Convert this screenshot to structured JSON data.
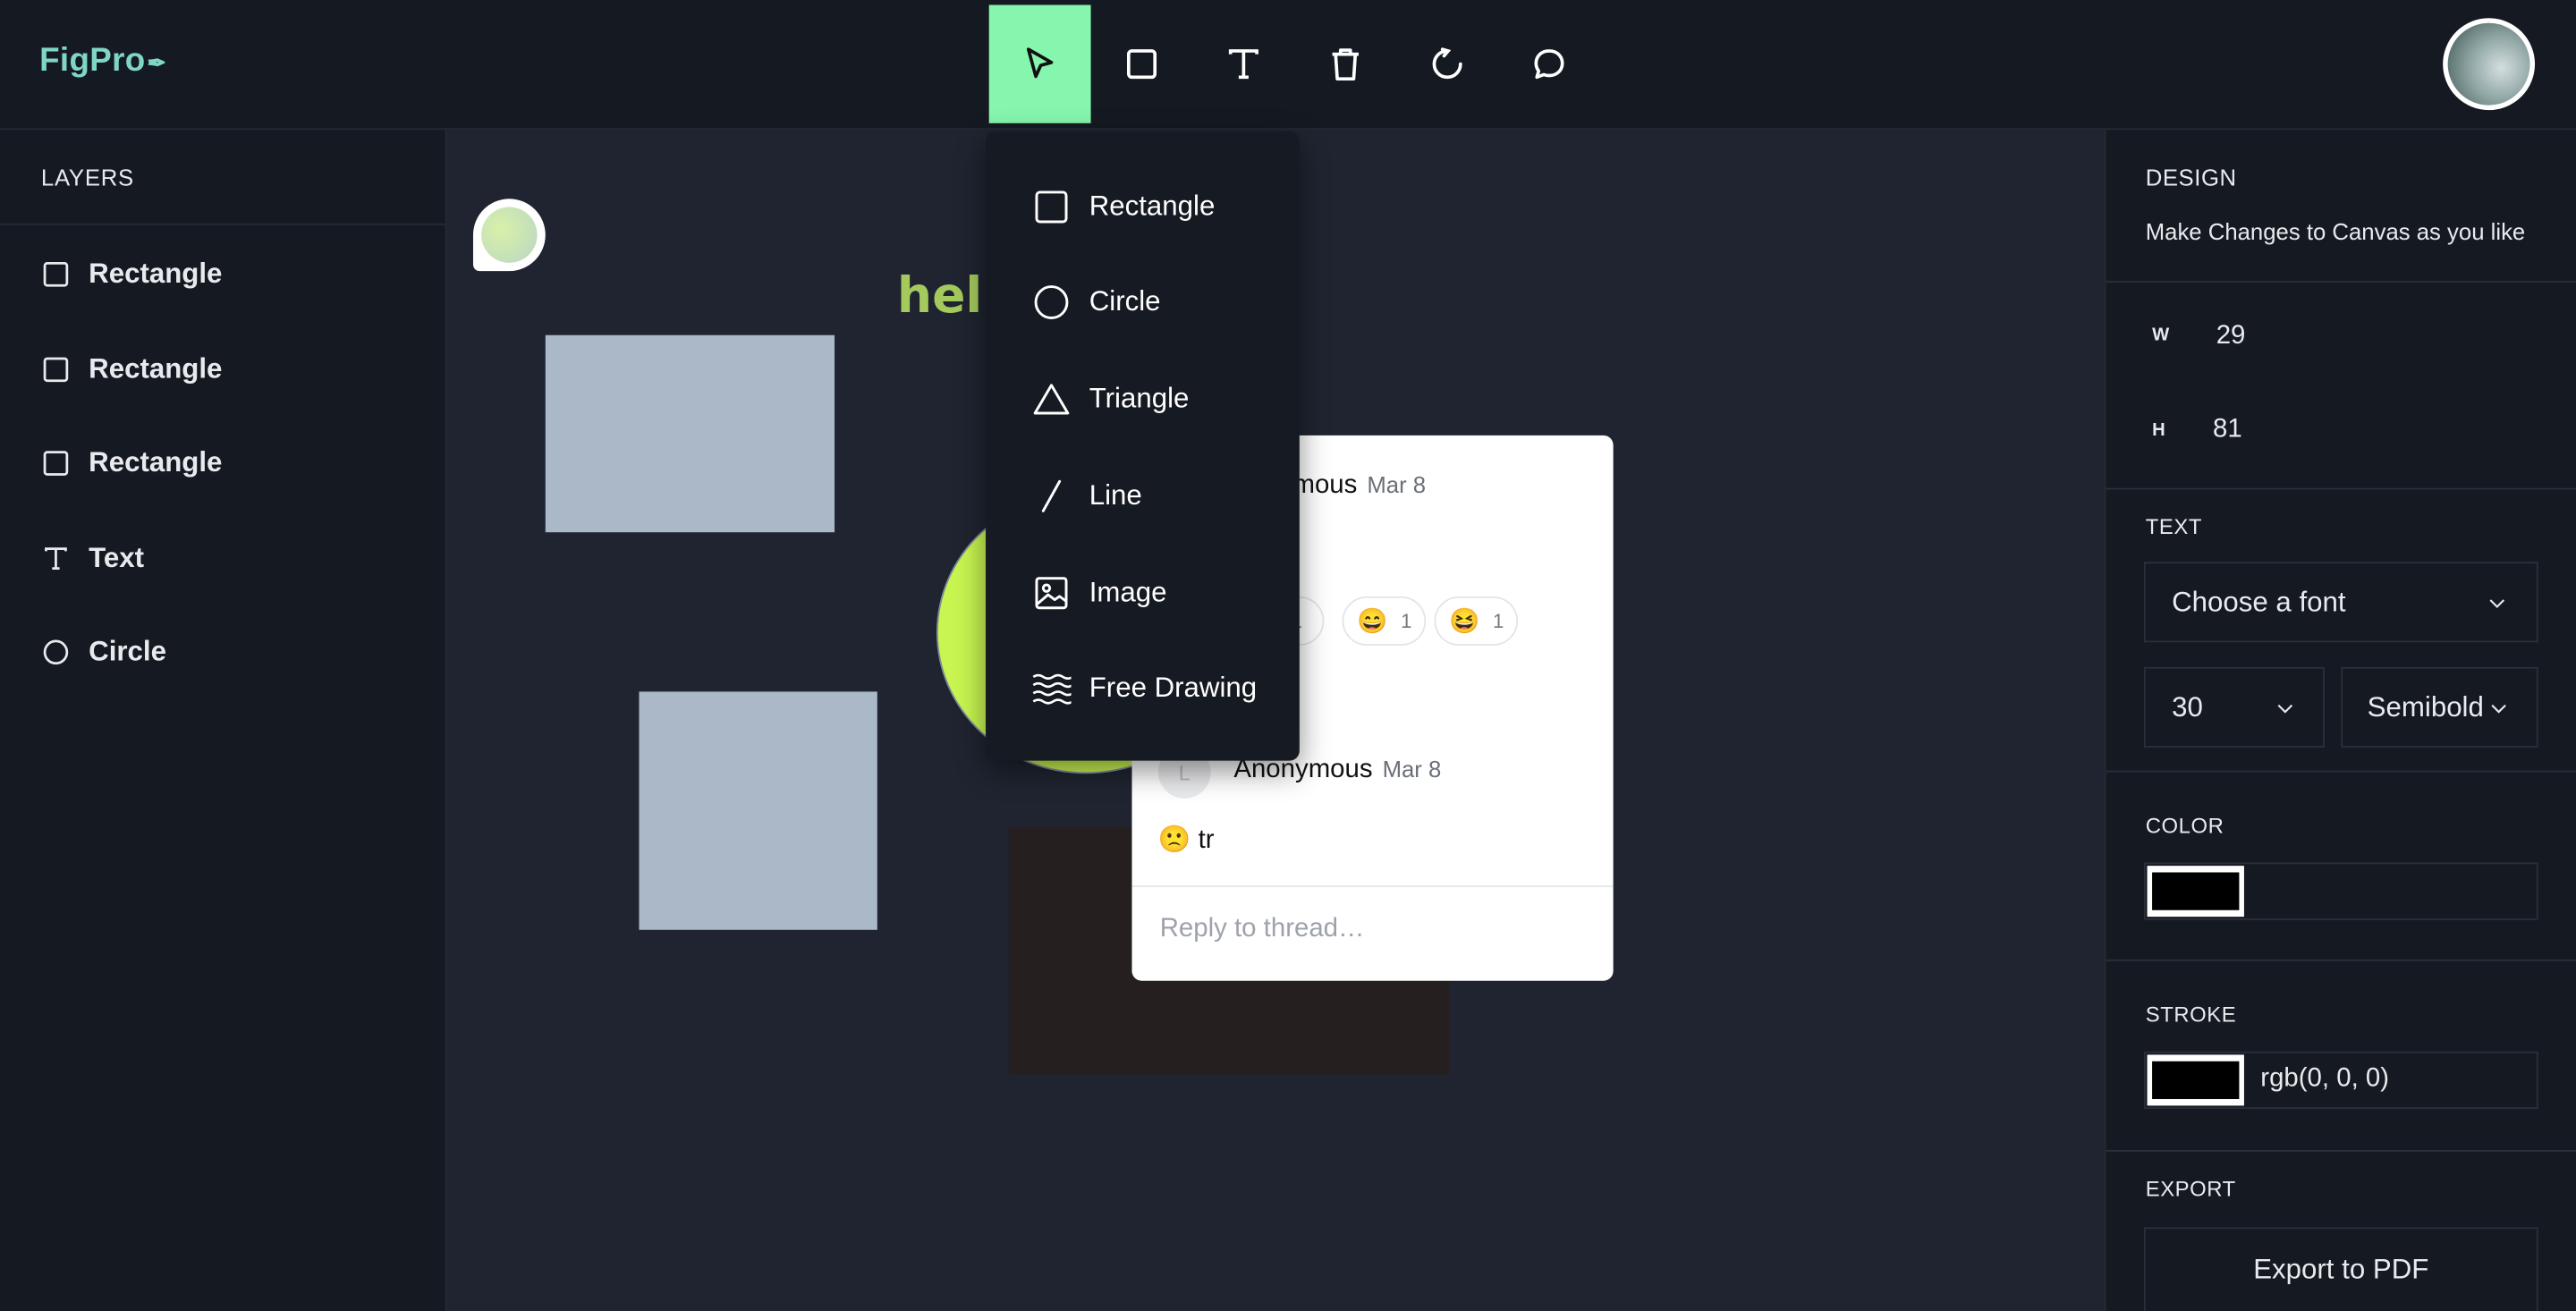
{
  "app": {
    "logo": "FigPro",
    "logo_icon": "pen-icon"
  },
  "toolbar": {
    "tools": [
      {
        "name": "select",
        "icon": "cursor-icon",
        "active": true
      },
      {
        "name": "rectangle",
        "icon": "square-icon"
      },
      {
        "name": "text",
        "icon": "text-icon"
      },
      {
        "name": "delete",
        "icon": "trash-icon"
      },
      {
        "name": "reset",
        "icon": "refresh-icon"
      },
      {
        "name": "comments",
        "icon": "chat-bubble-icon"
      }
    ],
    "active_color": "#86f5ad"
  },
  "layers": {
    "title": "LAYERS",
    "items": [
      {
        "label": "Rectangle",
        "icon": "square-icon"
      },
      {
        "label": "Rectangle",
        "icon": "square-icon"
      },
      {
        "label": "Rectangle",
        "icon": "square-icon"
      },
      {
        "label": "Text",
        "icon": "text-icon"
      },
      {
        "label": "Circle",
        "icon": "circle-icon"
      }
    ]
  },
  "shape_menu": {
    "items": [
      {
        "label": "Rectangle",
        "icon": "square-icon"
      },
      {
        "label": "Circle",
        "icon": "circle-icon"
      },
      {
        "label": "Triangle",
        "icon": "triangle-icon"
      },
      {
        "label": "Line",
        "icon": "line-icon"
      },
      {
        "label": "Image",
        "icon": "image-icon"
      },
      {
        "label": "Free Drawing",
        "icon": "waves-icon"
      }
    ]
  },
  "canvas": {
    "text_object": "hello",
    "text_color": "#a4c95c",
    "rect_color": "#aab8c8",
    "circle_color": "#c8f550",
    "dark_rect_color": "#261f1f"
  },
  "thread": {
    "comments": [
      {
        "author": "Anonymous",
        "date": "Mar 8"
      },
      {
        "author": "Anonymous",
        "date": "Mar 8",
        "avatar_letter": "L",
        "body": "🙁 tr"
      }
    ],
    "first_author_visible": "ymous",
    "reactions": [
      {
        "emoji": "",
        "count": "1"
      },
      {
        "emoji": "😄",
        "count": "1"
      },
      {
        "emoji": "😆",
        "count": "1"
      }
    ],
    "reply_placeholder": "Reply to thread…"
  },
  "design": {
    "title": "DESIGN",
    "subtitle": "Make Changes to Canvas as you like",
    "w_label": "W",
    "w_value": "29",
    "h_label": "H",
    "h_value": "81",
    "text_title": "TEXT",
    "font_placeholder": "Choose a font",
    "font_size": "30",
    "font_weight": "Semibold",
    "color_title": "COLOR",
    "color_value": "#000000",
    "stroke_title": "STROKE",
    "stroke_value": "rgb(0, 0, 0)",
    "export_title": "EXPORT",
    "export_button": "Export to PDF"
  }
}
